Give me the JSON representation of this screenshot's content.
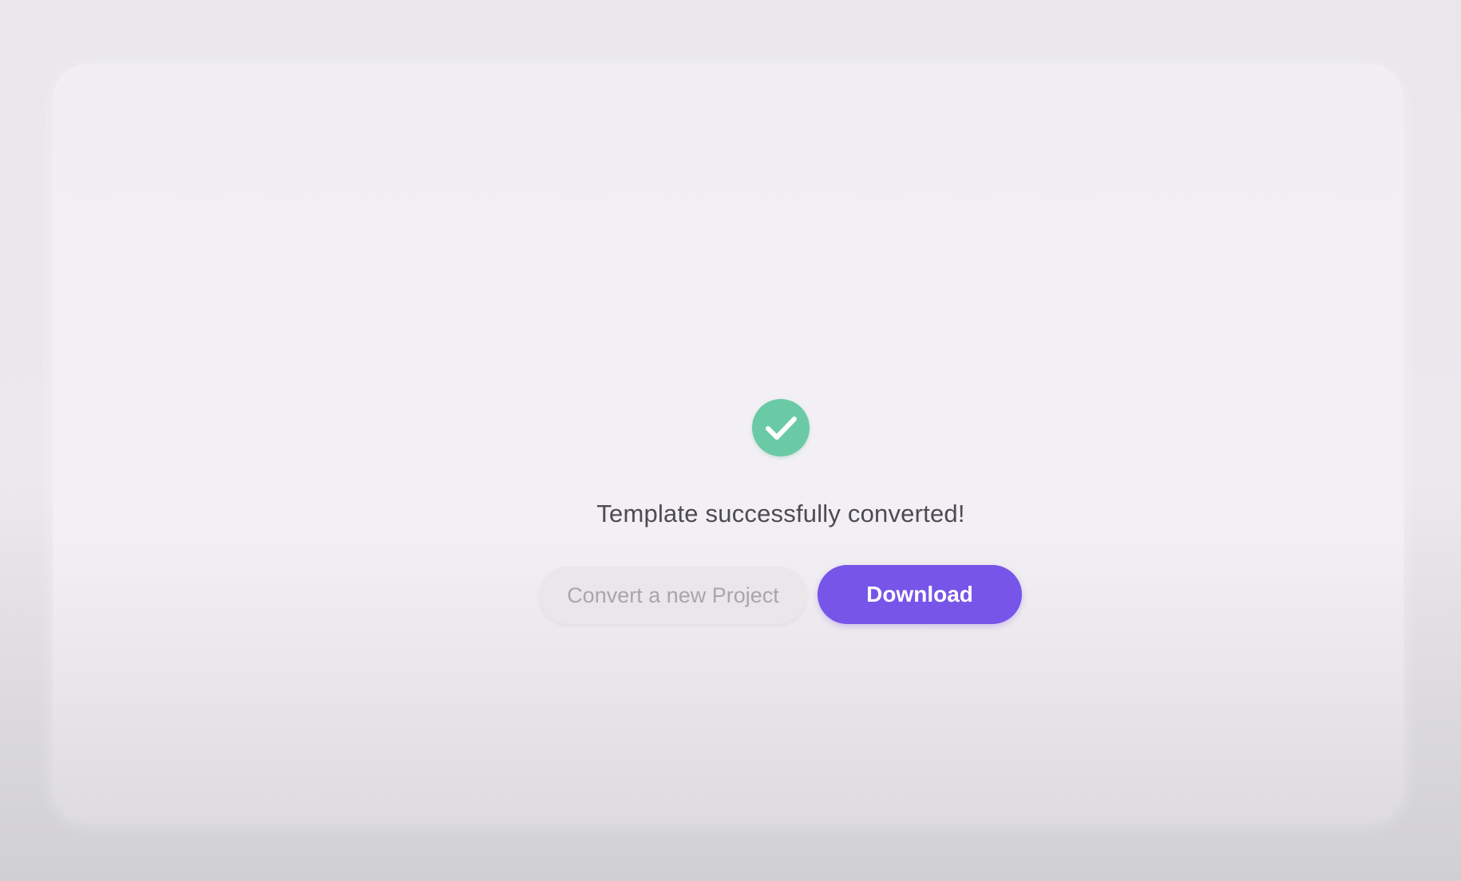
{
  "dialog": {
    "message": "Template successfully converted!",
    "status_icon": "check-circle-icon",
    "secondary_button_label": "Convert a new Project",
    "primary_button_label": "Download"
  },
  "colors": {
    "accent": "#7755e8",
    "success": "#6bcaa6",
    "background": "#eae8eb",
    "card": "#f2f0f4"
  }
}
